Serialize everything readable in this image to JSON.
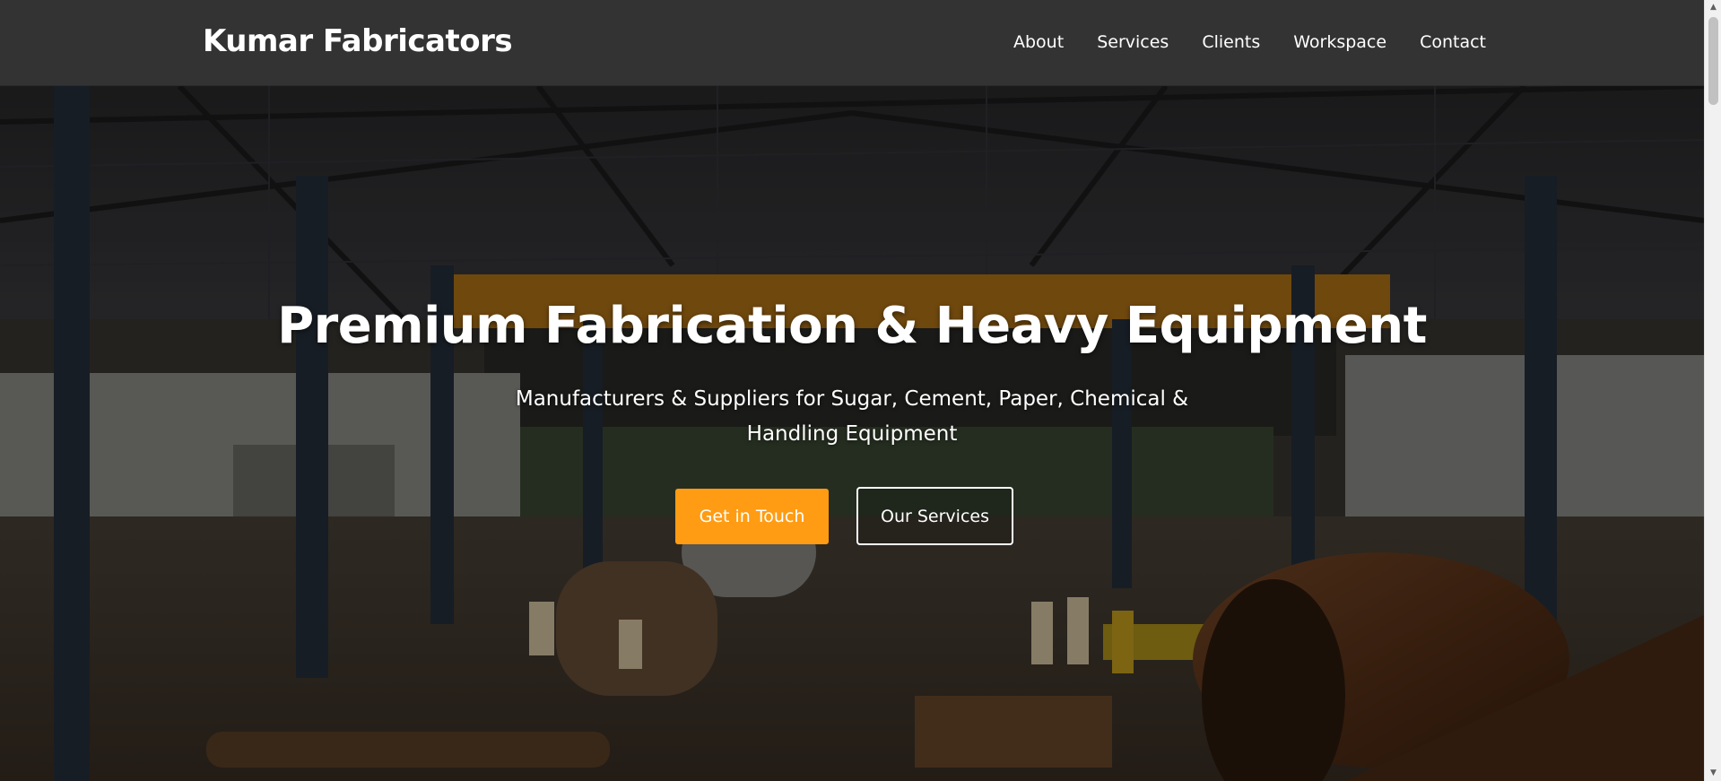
{
  "header": {
    "brand": "Kumar Fabricators",
    "nav": [
      "About",
      "Services",
      "Clients",
      "Workspace",
      "Contact"
    ]
  },
  "hero": {
    "title": "Premium Fabrication & Heavy Equipment",
    "subtitle": "Manufacturers & Suppliers for Sugar, Cement, Paper, Chemical & Handling Equipment",
    "primary_button": "Get in Touch",
    "secondary_button": "Our Services",
    "background_image": "factory-workshop-photo"
  },
  "scrollbar": {
    "up_arrow": "▲",
    "down_arrow": "▼"
  },
  "colors": {
    "header_bg": "#333333",
    "accent": "#ff9c13",
    "text": "#ffffff"
  }
}
